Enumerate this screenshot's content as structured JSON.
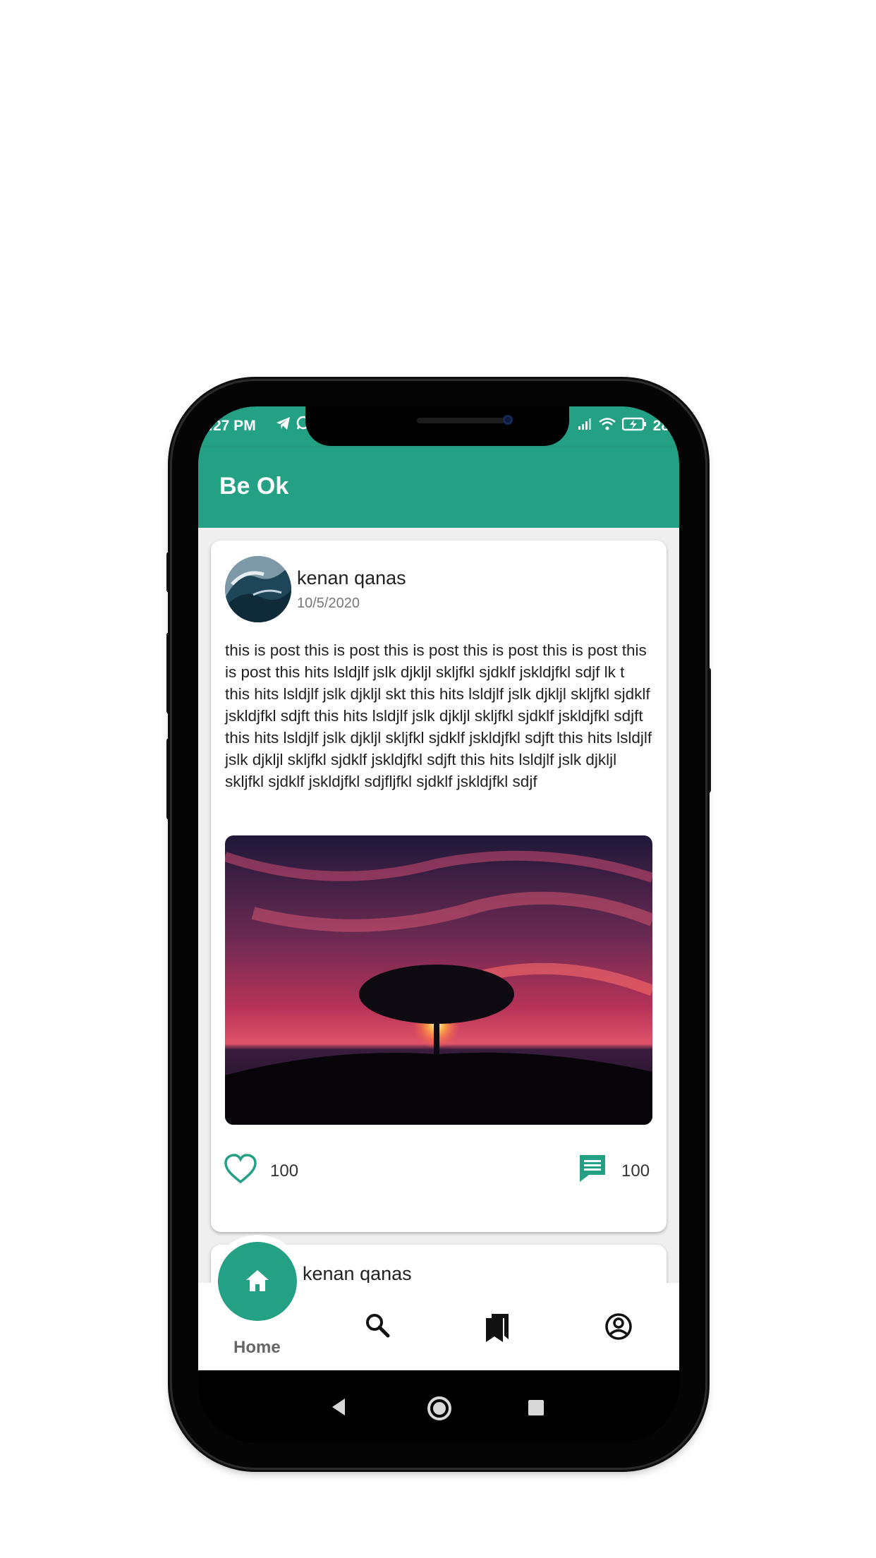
{
  "status_bar": {
    "time": ":27 PM",
    "left_icons": [
      "telegram-icon",
      "whatsapp-icon"
    ],
    "right_icons": [
      "signal-icon",
      "wifi-icon",
      "battery-charging-icon"
    ],
    "battery_text": "28"
  },
  "app_bar": {
    "title": "Be Ok"
  },
  "posts": [
    {
      "author": "kenan qanas",
      "date": "10/5/2020",
      "text": "this is post this is post this is post this is post this is post this is post this hits lsldjlf jslk djkljl skljfkl sjdklf jskldjfkl sdjf lk t this hits lsldjlf jslk djkljl skt this hits lsldjlf jslk djkljl skljfkl sjdklf jskldjfkl sdjft this hits lsldjlf jslk djkljl skljfkl sjdklf jskldjfkl sdjft this hits lsldjlf jslk djkljl skljfkl sjdklf jskldjfkl sdjft this hits lsldjlf jslk djkljl skljfkl sjdklf jskldjfkl sdjft this hits lsldjlf jslk djkljl skljfkl sjdklf jskldjfkl sdjfljfkl sjdklf jskldjfkl sdjf",
      "likes": "100",
      "comments": "100"
    },
    {
      "author": "kenan qanas"
    }
  ],
  "bottom_nav": {
    "home_label": "Home",
    "items": [
      "home-icon",
      "search-icon",
      "bookmarks-icon",
      "account-icon"
    ]
  },
  "colors": {
    "primary": "#24a085",
    "background": "#efefef",
    "card": "#ffffff"
  }
}
